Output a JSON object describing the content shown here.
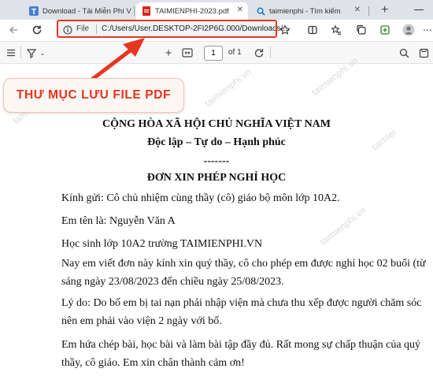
{
  "tabs": [
    {
      "label": "Download - Tải Miễn Phí V",
      "icon": "site-t-icon"
    },
    {
      "label": "TAIMIENPHI-2023.pdf",
      "icon": "pdf-icon"
    },
    {
      "label": "taimienphi - Tìm kiếm",
      "icon": "search-icon"
    }
  ],
  "address": {
    "scheme": "File",
    "path": "C:/Users/User.DESKTOP-2FI2P6G.000/Downloads/..."
  },
  "pdf_toolbar": {
    "page": "1",
    "of": "of 1"
  },
  "annotation": {
    "badge": "THƯ MỤC LƯU FILE PDF"
  },
  "watermark": "taimienphi.vn",
  "document": {
    "line1": "CỘNG HÒA XÃ HỘI CHỦ NGHĨA VIỆT NAM",
    "line2": "Độc lập – Tự do – Hạnh phúc",
    "line3": "-------",
    "title": "ĐƠN XIN PHÉP NGHỈ HỌC",
    "p1": "Kính gửi: Cô chủ nhiệm cùng thầy (cô) giáo bộ môn lớp 10A2.",
    "p2": "Em tên là: Nguyễn Văn A",
    "p3": "Học sinh lớp 10A2 trường TAIMIENPHI.VN",
    "p4a": "Nay em viết đơn này kính xin quý thầy, cô cho phép em được nghỉ học 02 buổi (từ",
    "p4b": "sáng ngày 23/08/2023 đến chiều ngày 25/08/2023.",
    "p5a": "Lý do: Do bố em bị tai nạn phải nhập viện mà chưa thu xếp được người chăm sóc",
    "p5b": "nên em phải vào viện 2 ngày với bố.",
    "p6a": "Em hứa chép bài, học bài và làm bài tập đầy đủ. Rất mong sự chấp thuận của quý",
    "p6b": "thầy, cô giáo. Em xin chân thành cảm ơn!"
  },
  "colors": {
    "accent_red": "#e8351f",
    "tabbar_bg": "#dfe3e8"
  }
}
